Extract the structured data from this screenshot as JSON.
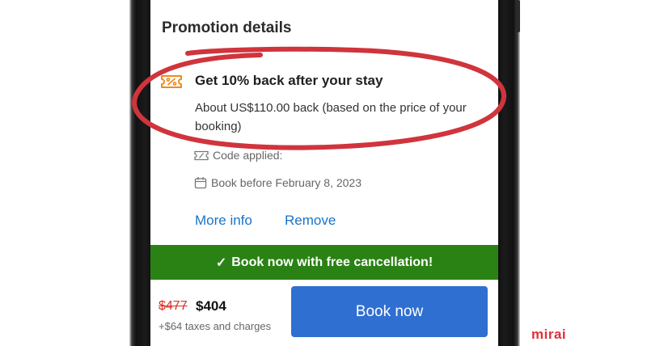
{
  "section": {
    "title": "Promotion details"
  },
  "promotion": {
    "icon": "coupon-icon",
    "title": "Get 10% back after your stay",
    "description": "About US$110.00 back (based on the price of your booking)",
    "code_label": "Code applied:",
    "deadline": "Book before February 8, 2023"
  },
  "actions": {
    "more_info": "More info",
    "remove": "Remove"
  },
  "banner": {
    "check": "✓",
    "text": "Book now with free cancellation!"
  },
  "pricing": {
    "original_price": "$477",
    "current_price": "$404",
    "taxes": "+$64 taxes and charges"
  },
  "book_button": {
    "label": "Book now"
  },
  "brand": {
    "logo_text": "mirai"
  },
  "colors": {
    "accent_blue": "#2f6fd1",
    "link_blue": "#1a73c8",
    "banner_green": "#2a8214",
    "strike_red": "#d93025",
    "annotation_red": "#d0343c",
    "coupon_orange": "#f08a1c"
  }
}
